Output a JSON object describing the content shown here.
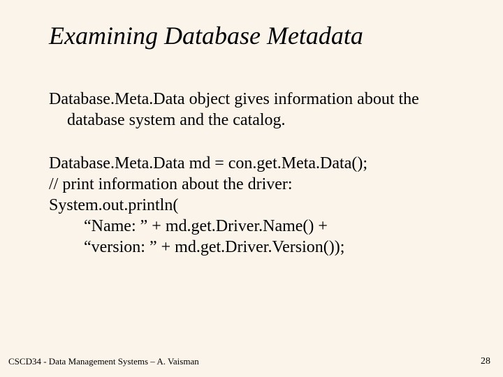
{
  "title": "Examining Database Metadata",
  "intro": "Database.Meta.Data object gives information about the database system and the catalog.",
  "code": {
    "l1": "Database.Meta.Data md = con.get.Meta.Data();",
    "l2": "// print information about the driver:",
    "l3": "System.out.println(",
    "l4": "“Name: ” + md.get.Driver.Name() +",
    "l5": "“version: ” + md.get.Driver.Version());"
  },
  "footer": "CSCD34 - Data Management Systems – A. Vaisman",
  "page": "28"
}
